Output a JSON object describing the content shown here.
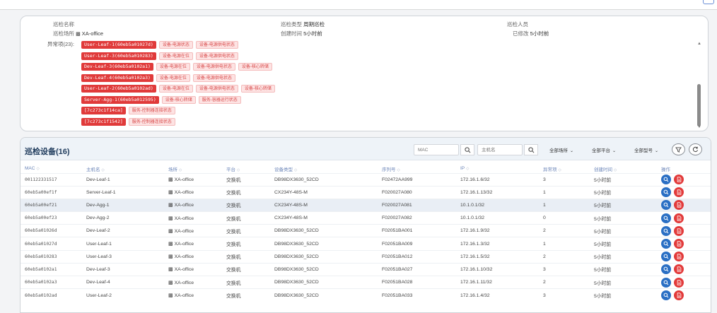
{
  "inspection": {
    "name_label": "巡检名称",
    "name_value": "",
    "site_label": "巡检场所",
    "site_value": "XA-office",
    "type_label": "巡检类型",
    "type_value": "周期巡检",
    "created_label": "创建时间",
    "created_value": "5小时前",
    "inspector_label": "巡检人员",
    "inspector_value": "",
    "modified_label": "已修改",
    "modified_value": "5小时前",
    "abnormal_label": "异常项(23):"
  },
  "abnormal_items": [
    {
      "device": "User-Leaf-1(60eb5a01027d)",
      "issues": [
        "设备-电源状态",
        "设备-电源供电状态"
      ]
    },
    {
      "device": "User-Leaf-3(60eb5a010283)",
      "issues": [
        "设备-电源在位",
        "设备-电源供电状态"
      ]
    },
    {
      "device": "Dev-Leaf-3(60eb5a0102a1)",
      "issues": [
        "设备-电源在位",
        "设备-电源供电状态",
        "设备-核心转储"
      ]
    },
    {
      "device": "Dev-Leaf-4(60eb5a0102a3)",
      "issues": [
        "设备-电源在位",
        "设备-电源供电状态"
      ]
    },
    {
      "device": "User-Leaf-2(60eb5a0102ad)",
      "issues": [
        "设备-电源在位",
        "设备-电源供电状态",
        "设备-核心转储"
      ]
    },
    {
      "device": "Server-Agg-1(60eb5a012595)",
      "issues": [
        "设备-核心转储",
        "服务-容器运行状态"
      ]
    },
    {
      "device": "[7c273c1f14ca]",
      "issues": [
        "服务-控制器连接状态"
      ]
    },
    {
      "device": "[7c273c1f1542]",
      "issues": [
        "服务-控制器连接状态"
      ]
    }
  ],
  "devices_panel": {
    "title": "巡检设备(16)",
    "mac_placeholder": "MAC",
    "hostname_placeholder": "主机名",
    "filter_site": "全部场所",
    "filter_platform": "全部平台",
    "filter_model": "全部型号",
    "columns": {
      "mac": "MAC",
      "hostname": "主机名",
      "site": "场所",
      "platform": "平台",
      "device_type": "设备类型",
      "serial": "序列号",
      "ip": "IP",
      "abnormal": "异常项",
      "created": "创建时间",
      "actions": "操作"
    },
    "rows": [
      {
        "mac": "001122331517",
        "hostname": "Dev-Leaf-1",
        "site": "XA-office",
        "platform": "交换机",
        "type": "DB98DX3630_52CD",
        "serial": "F02472AA999",
        "ip": "172.16.1.6/32",
        "abnormal": "3",
        "created": "5小时前"
      },
      {
        "mac": "60eb5a00ef1f",
        "hostname": "Server-Leaf-1",
        "site": "XA-office",
        "platform": "交换机",
        "type": "CX234Y-48S-M",
        "serial": "F020027A080",
        "ip": "172.16.1.13/32",
        "abnormal": "1",
        "created": "5小时前"
      },
      {
        "mac": "60eb5a00ef21",
        "hostname": "Dev-Agg-1",
        "site": "XA-office",
        "platform": "交换机",
        "type": "CX234Y-48S-M",
        "serial": "F020027A081",
        "ip": "10.1.0.1/32",
        "abnormal": "1",
        "created": "5小时前"
      },
      {
        "mac": "60eb5a00ef23",
        "hostname": "Dev-Agg-2",
        "site": "XA-office",
        "platform": "交换机",
        "type": "CX234Y-48S-M",
        "serial": "F020027A082",
        "ip": "10.1.0.1/32",
        "abnormal": "0",
        "created": "5小时前"
      },
      {
        "mac": "60eb5a01026d",
        "hostname": "Dev-Leaf-2",
        "site": "XA-office",
        "platform": "交换机",
        "type": "DB98DX3630_52CD",
        "serial": "F02051BA001",
        "ip": "172.16.1.9/32",
        "abnormal": "2",
        "created": "5小时前"
      },
      {
        "mac": "60eb5a01027d",
        "hostname": "User-Leaf-1",
        "site": "XA-office",
        "platform": "交换机",
        "type": "DB98DX3630_52CD",
        "serial": "F02051BA009",
        "ip": "172.16.1.3/32",
        "abnormal": "1",
        "created": "5小时前"
      },
      {
        "mac": "60eb5a010283",
        "hostname": "User-Leaf-3",
        "site": "XA-office",
        "platform": "交换机",
        "type": "DB98DX3630_52CD",
        "serial": "F02051BA012",
        "ip": "172.16.1.5/32",
        "abnormal": "2",
        "created": "5小时前"
      },
      {
        "mac": "60eb5a0102a1",
        "hostname": "Dev-Leaf-3",
        "site": "XA-office",
        "platform": "交换机",
        "type": "DB98DX3630_52CD",
        "serial": "F02051BA027",
        "ip": "172.16.1.10/32",
        "abnormal": "3",
        "created": "5小时前"
      },
      {
        "mac": "60eb5a0102a3",
        "hostname": "Dev-Leaf-4",
        "site": "XA-office",
        "platform": "交换机",
        "type": "DB98DX3630_52CD",
        "serial": "F02051BA028",
        "ip": "172.16.1.11/32",
        "abnormal": "2",
        "created": "5小时前"
      },
      {
        "mac": "60eb5a0102ad",
        "hostname": "User-Leaf-2",
        "site": "XA-office",
        "platform": "交换机",
        "type": "DB98DX3630_52CD",
        "serial": "F02051BA033",
        "ip": "172.16.1.4/32",
        "abnormal": "3",
        "created": "5小时前"
      }
    ]
  },
  "colors": {
    "accent_blue": "#2a6fc4",
    "danger_red": "#e03a3a",
    "tag_bg": "#fde3e3",
    "header_bg": "#eef3f8"
  },
  "icons": {
    "site": "building-icon",
    "search": "search-icon",
    "filter": "filter-icon",
    "refresh": "refresh-icon",
    "view": "search-icon",
    "report": "report-icon"
  }
}
